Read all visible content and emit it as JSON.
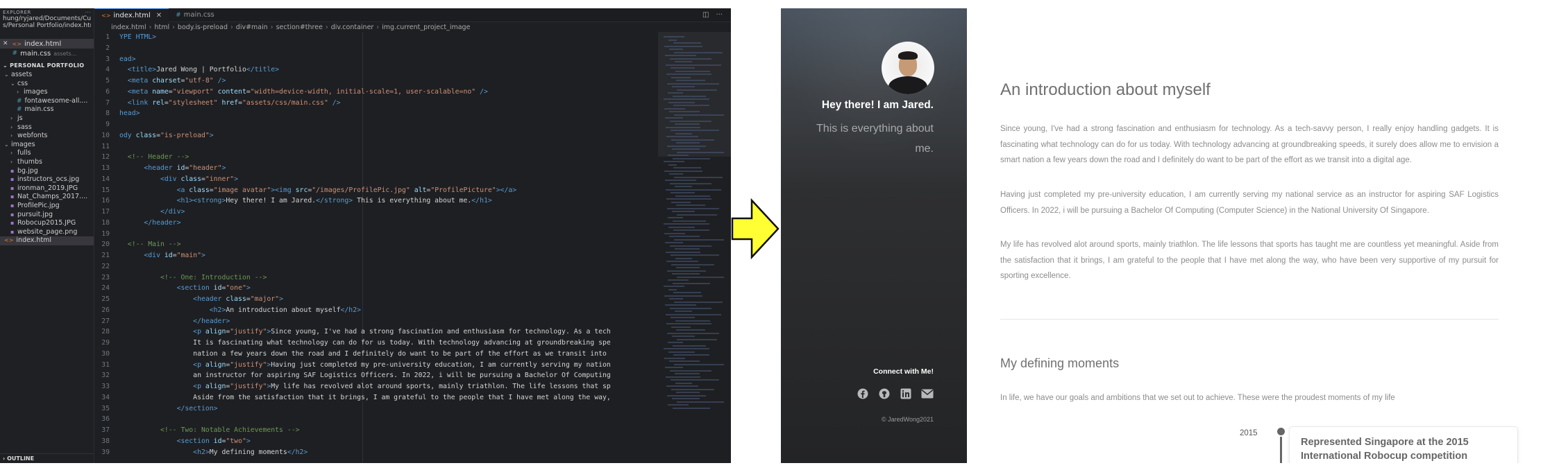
{
  "editor": {
    "explorer": {
      "header_left": "EXPLORER",
      "path_line1": "hung/ryjared/Documents/Current",
      "path_line2": "s/Personal Portfolio/index.html",
      "open_editors": [
        {
          "name": "index.html",
          "kind": "html",
          "subtitle": ""
        },
        {
          "name": "main.css",
          "kind": "css",
          "subtitle": "assets..."
        }
      ],
      "project_title": "PERSONAL PORTFOLIO",
      "tree": [
        {
          "label": "assets",
          "indent": 0,
          "folder": true,
          "open": true
        },
        {
          "label": "css",
          "indent": 1,
          "folder": true,
          "open": true
        },
        {
          "label": "images",
          "indent": 2,
          "folder": true,
          "open": false
        },
        {
          "label": "fontawesome-all....",
          "indent": 2,
          "folder": false,
          "kind": "css"
        },
        {
          "label": "main.css",
          "indent": 2,
          "folder": false,
          "kind": "css"
        },
        {
          "label": "js",
          "indent": 1,
          "folder": true,
          "open": false
        },
        {
          "label": "sass",
          "indent": 1,
          "folder": true,
          "open": false
        },
        {
          "label": "webfonts",
          "indent": 1,
          "folder": true,
          "open": false
        },
        {
          "label": "images",
          "indent": 0,
          "folder": true,
          "open": true
        },
        {
          "label": "fulls",
          "indent": 1,
          "folder": true,
          "open": false
        },
        {
          "label": "thumbs",
          "indent": 1,
          "folder": true,
          "open": false
        },
        {
          "label": "bg.jpg",
          "indent": 1,
          "folder": false,
          "kind": "img"
        },
        {
          "label": "instructors_ocs.jpg",
          "indent": 1,
          "folder": false,
          "kind": "img"
        },
        {
          "label": "ironman_2019.JPG",
          "indent": 1,
          "folder": false,
          "kind": "img"
        },
        {
          "label": "Nat_Champs_2017....",
          "indent": 1,
          "folder": false,
          "kind": "img"
        },
        {
          "label": "ProfilePic.jpg",
          "indent": 1,
          "folder": false,
          "kind": "img"
        },
        {
          "label": "pursuit.jpg",
          "indent": 1,
          "folder": false,
          "kind": "img"
        },
        {
          "label": "Robocup2015.JPG",
          "indent": 1,
          "folder": false,
          "kind": "img"
        },
        {
          "label": "website_page.png",
          "indent": 1,
          "folder": false,
          "kind": "img"
        },
        {
          "label": "index.html",
          "indent": 0,
          "folder": false,
          "kind": "html",
          "active": true
        }
      ],
      "outline_label": "OUTLINE"
    },
    "tabs": [
      {
        "label": "index.html",
        "active": true
      },
      {
        "label": "main.css",
        "active": false
      }
    ],
    "breadcrumb": [
      "index.html",
      "html",
      "body.is-preload",
      "div#main",
      "section#three",
      "div.container",
      "img.current_project_image"
    ],
    "code_lines": [
      {
        "n": "1",
        "segs": [
          {
            "t": "YPE HTML>",
            "c": "#569cd6"
          }
        ]
      },
      {
        "n": "2",
        "segs": []
      },
      {
        "n": "3",
        "segs": [
          {
            "t": "ead>",
            "c": "#569cd6"
          }
        ]
      },
      {
        "n": "4",
        "segs": [
          {
            "t": "  <title>",
            "c": "#569cd6"
          },
          {
            "t": "Jared Wong | Portfolio",
            "c": "#d4d4d4"
          },
          {
            "t": "</title>",
            "c": "#569cd6"
          }
        ]
      },
      {
        "n": "5",
        "segs": [
          {
            "t": "  <meta ",
            "c": "#569cd6"
          },
          {
            "t": "charset",
            "c": "#9cdcfe"
          },
          {
            "t": "=",
            "c": "#d4d4d4"
          },
          {
            "t": "\"utf-8\"",
            "c": "#ce9178"
          },
          {
            "t": " />",
            "c": "#569cd6"
          }
        ]
      },
      {
        "n": "6",
        "segs": [
          {
            "t": "  <meta ",
            "c": "#569cd6"
          },
          {
            "t": "name",
            "c": "#9cdcfe"
          },
          {
            "t": "=",
            "c": "#d4d4d4"
          },
          {
            "t": "\"viewport\"",
            "c": "#ce9178"
          },
          {
            "t": " content",
            "c": "#9cdcfe"
          },
          {
            "t": "=",
            "c": "#d4d4d4"
          },
          {
            "t": "\"width=device-width, initial-scale=1, user-scalable=no\"",
            "c": "#ce9178"
          },
          {
            "t": " />",
            "c": "#569cd6"
          }
        ]
      },
      {
        "n": "7",
        "segs": [
          {
            "t": "  <link ",
            "c": "#569cd6"
          },
          {
            "t": "rel",
            "c": "#9cdcfe"
          },
          {
            "t": "=",
            "c": "#d4d4d4"
          },
          {
            "t": "\"stylesheet\"",
            "c": "#ce9178"
          },
          {
            "t": " href",
            "c": "#9cdcfe"
          },
          {
            "t": "=",
            "c": "#d4d4d4"
          },
          {
            "t": "\"assets/css/main.css\"",
            "c": "#ce9178"
          },
          {
            "t": " />",
            "c": "#569cd6"
          }
        ]
      },
      {
        "n": "8",
        "segs": [
          {
            "t": "head>",
            "c": "#569cd6"
          }
        ]
      },
      {
        "n": "9",
        "segs": []
      },
      {
        "n": "10",
        "segs": [
          {
            "t": "ody ",
            "c": "#569cd6"
          },
          {
            "t": "class",
            "c": "#9cdcfe"
          },
          {
            "t": "=",
            "c": "#d4d4d4"
          },
          {
            "t": "\"is-preload\"",
            "c": "#ce9178"
          },
          {
            "t": ">",
            "c": "#569cd6"
          }
        ]
      },
      {
        "n": "11",
        "segs": []
      },
      {
        "n": "12",
        "segs": [
          {
            "t": "  <!-- Header -->",
            "c": "#6a9955"
          }
        ]
      },
      {
        "n": "13",
        "segs": [
          {
            "t": "      <header ",
            "c": "#569cd6"
          },
          {
            "t": "id",
            "c": "#9cdcfe"
          },
          {
            "t": "=",
            "c": "#d4d4d4"
          },
          {
            "t": "\"header\"",
            "c": "#ce9178"
          },
          {
            "t": ">",
            "c": "#569cd6"
          }
        ]
      },
      {
        "n": "14",
        "segs": [
          {
            "t": "          <div ",
            "c": "#569cd6"
          },
          {
            "t": "class",
            "c": "#9cdcfe"
          },
          {
            "t": "=",
            "c": "#d4d4d4"
          },
          {
            "t": "\"inner\"",
            "c": "#ce9178"
          },
          {
            "t": ">",
            "c": "#569cd6"
          }
        ]
      },
      {
        "n": "15",
        "segs": [
          {
            "t": "              <a ",
            "c": "#569cd6"
          },
          {
            "t": "class",
            "c": "#9cdcfe"
          },
          {
            "t": "=",
            "c": "#d4d4d4"
          },
          {
            "t": "\"image avatar\"",
            "c": "#ce9178"
          },
          {
            "t": "><img ",
            "c": "#569cd6"
          },
          {
            "t": "src",
            "c": "#9cdcfe"
          },
          {
            "t": "=",
            "c": "#d4d4d4"
          },
          {
            "t": "\"/images/ProfilePic.jpg\"",
            "c": "#ce9178"
          },
          {
            "t": " alt",
            "c": "#9cdcfe"
          },
          {
            "t": "=",
            "c": "#d4d4d4"
          },
          {
            "t": "\"ProfilePicture\"",
            "c": "#ce9178"
          },
          {
            "t": "></a>",
            "c": "#569cd6"
          }
        ]
      },
      {
        "n": "16",
        "segs": [
          {
            "t": "              <h1><strong>",
            "c": "#569cd6"
          },
          {
            "t": "Hey there! I am Jared.",
            "c": "#d4d4d4"
          },
          {
            "t": "</strong>",
            "c": "#569cd6"
          },
          {
            "t": " This is everything about me.",
            "c": "#d4d4d4"
          },
          {
            "t": "</h1>",
            "c": "#569cd6"
          }
        ]
      },
      {
        "n": "17",
        "segs": [
          {
            "t": "          </div>",
            "c": "#569cd6"
          }
        ]
      },
      {
        "n": "18",
        "segs": [
          {
            "t": "      </header>",
            "c": "#569cd6"
          }
        ]
      },
      {
        "n": "19",
        "segs": []
      },
      {
        "n": "20",
        "segs": [
          {
            "t": "  <!-- Main -->",
            "c": "#6a9955"
          }
        ]
      },
      {
        "n": "21",
        "segs": [
          {
            "t": "      <div ",
            "c": "#569cd6"
          },
          {
            "t": "id",
            "c": "#9cdcfe"
          },
          {
            "t": "=",
            "c": "#d4d4d4"
          },
          {
            "t": "\"main\"",
            "c": "#ce9178"
          },
          {
            "t": ">",
            "c": "#569cd6"
          }
        ]
      },
      {
        "n": "22",
        "segs": []
      },
      {
        "n": "23",
        "segs": [
          {
            "t": "          <!-- One: Introduction -->",
            "c": "#6a9955"
          }
        ]
      },
      {
        "n": "24",
        "segs": [
          {
            "t": "              <section ",
            "c": "#569cd6"
          },
          {
            "t": "id",
            "c": "#9cdcfe"
          },
          {
            "t": "=",
            "c": "#d4d4d4"
          },
          {
            "t": "\"one\"",
            "c": "#ce9178"
          },
          {
            "t": ">",
            "c": "#569cd6"
          }
        ]
      },
      {
        "n": "25",
        "segs": [
          {
            "t": "                  <header ",
            "c": "#569cd6"
          },
          {
            "t": "class",
            "c": "#9cdcfe"
          },
          {
            "t": "=",
            "c": "#d4d4d4"
          },
          {
            "t": "\"major\"",
            "c": "#ce9178"
          },
          {
            "t": ">",
            "c": "#569cd6"
          }
        ]
      },
      {
        "n": "26",
        "segs": [
          {
            "t": "                      <h2>",
            "c": "#569cd6"
          },
          {
            "t": "An introduction about myself",
            "c": "#d4d4d4"
          },
          {
            "t": "</h2>",
            "c": "#569cd6"
          }
        ]
      },
      {
        "n": "27",
        "segs": [
          {
            "t": "                  </header>",
            "c": "#569cd6"
          }
        ]
      },
      {
        "n": "28",
        "segs": [
          {
            "t": "                  <p ",
            "c": "#569cd6"
          },
          {
            "t": "align",
            "c": "#9cdcfe"
          },
          {
            "t": "=",
            "c": "#d4d4d4"
          },
          {
            "t": "\"justify\"",
            "c": "#ce9178"
          },
          {
            "t": ">",
            "c": "#569cd6"
          },
          {
            "t": "Since young, I've had a strong fascination and enthusiasm for technology. As a tech",
            "c": "#d4d4d4"
          }
        ]
      },
      {
        "n": "29",
        "segs": [
          {
            "t": "                  It is fascinating what technology can do for us today. With technology advancing at groundbreaking spe",
            "c": "#d4d4d4"
          }
        ]
      },
      {
        "n": "30",
        "segs": [
          {
            "t": "                  nation a few years down the road and I definitely do want to be part of the effort as we transit into",
            "c": "#d4d4d4"
          }
        ]
      },
      {
        "n": "31",
        "segs": [
          {
            "t": "                  <p ",
            "c": "#569cd6"
          },
          {
            "t": "align",
            "c": "#9cdcfe"
          },
          {
            "t": "=",
            "c": "#d4d4d4"
          },
          {
            "t": "\"justify\"",
            "c": "#ce9178"
          },
          {
            "t": ">",
            "c": "#569cd6"
          },
          {
            "t": "Having just completed my pre-university education, I am currently serving my nation",
            "c": "#d4d4d4"
          }
        ]
      },
      {
        "n": "32",
        "segs": [
          {
            "t": "                  an instructor for aspiring SAF Logistics Officers. In 2022, i will be pursuing a Bachelor Of Computing",
            "c": "#d4d4d4"
          }
        ]
      },
      {
        "n": "33",
        "segs": [
          {
            "t": "                  <p ",
            "c": "#569cd6"
          },
          {
            "t": "align",
            "c": "#9cdcfe"
          },
          {
            "t": "=",
            "c": "#d4d4d4"
          },
          {
            "t": "\"justify\"",
            "c": "#ce9178"
          },
          {
            "t": ">",
            "c": "#569cd6"
          },
          {
            "t": "My life has revolved alot around sports, mainly triathlon. The life lessons that sp",
            "c": "#d4d4d4"
          }
        ]
      },
      {
        "n": "34",
        "segs": [
          {
            "t": "                  Aside from the satisfaction that it brings, I am grateful to the people that I have met along the way,",
            "c": "#d4d4d4"
          }
        ]
      },
      {
        "n": "35",
        "segs": [
          {
            "t": "              </section>",
            "c": "#569cd6"
          }
        ]
      },
      {
        "n": "36",
        "segs": []
      },
      {
        "n": "37",
        "segs": [
          {
            "t": "          <!-- Two: Notable Achievements -->",
            "c": "#6a9955"
          }
        ]
      },
      {
        "n": "38",
        "segs": [
          {
            "t": "              <section ",
            "c": "#569cd6"
          },
          {
            "t": "id",
            "c": "#9cdcfe"
          },
          {
            "t": "=",
            "c": "#d4d4d4"
          },
          {
            "t": "\"two\"",
            "c": "#ce9178"
          },
          {
            "t": ">",
            "c": "#569cd6"
          }
        ]
      },
      {
        "n": "39",
        "segs": [
          {
            "t": "                  <h2>",
            "c": "#569cd6"
          },
          {
            "t": "My defining moments",
            "c": "#d4d4d4"
          },
          {
            "t": "</h2>",
            "c": "#569cd6"
          }
        ]
      }
    ]
  },
  "preview": {
    "hero_bold": "Hey there! I am Jared.",
    "hero_sub": "This is everything about me.",
    "connect_label": "Connect with Me!",
    "socials": [
      {
        "icon": "facebook-icon"
      },
      {
        "icon": "github-icon"
      },
      {
        "icon": "linkedin-icon"
      },
      {
        "icon": "envelope-icon"
      }
    ],
    "copyright": "© JaredWong2021",
    "section_one_title": "An introduction about myself",
    "paragraphs": [
      "Since young, I've had a strong fascination and enthusiasm for technology. As a tech-savvy person, I really enjoy handling gadgets. It is fascinating what technology can do for us today. With technology advancing at groundbreaking speeds, it surely does allow me to envision a smart nation a few years down the road and I definitely do want to be part of the effort as we transit into a digital age.",
      "Having just completed my pre-university education, I am currently serving my national service as an instructor for aspiring SAF Logistics Officers. In 2022, i will be pursuing a Bachelor Of Computing (Computer Science) in the National University Of Singapore.",
      "My life has revolved alot around sports, mainly triathlon. The life lessons that sports has taught me are countless yet meaningful. Aside from the satisfaction that it brings, I am grateful to the people that I have met along the way, who have been very supportive of my pursuit for sporting excellence."
    ],
    "section_two_title": "My defining moments",
    "section_two_intro": "In life, we have our goals and ambitions that we set out to achieve. These were the proudest moments of my life",
    "timeline": [
      {
        "year": "2015",
        "title": "Represented Singapore at the 2015 International Robocup competition"
      }
    ]
  },
  "colors": {
    "arrow_fill": "#ffff33",
    "accent_tab": "#3a7bd5"
  }
}
